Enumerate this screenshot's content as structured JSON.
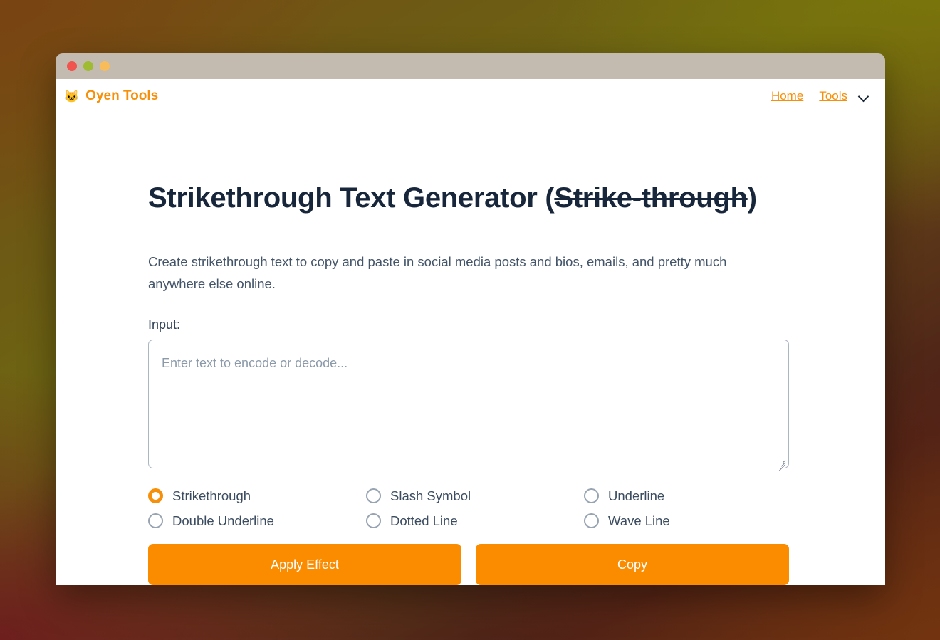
{
  "window": {
    "traffic_lights": [
      "close",
      "minimize",
      "maximize"
    ]
  },
  "header": {
    "brand_emoji": "🐱",
    "brand_name": "Oyen Tools",
    "nav": [
      {
        "label": "Home"
      },
      {
        "label": "Tools"
      }
    ],
    "nav_caret_icon": "chevron-down-icon"
  },
  "main": {
    "title_plain": "Strikethrough Text Generator (",
    "title_struck": "Strike-through",
    "title_tail": ")",
    "description": "Create strikethrough text to copy and paste in social media posts and bios, emails, and pretty much anywhere else online.",
    "input_label": "Input:",
    "input_placeholder": "Enter text to encode or decode...",
    "input_value": "",
    "options": [
      {
        "label": "Strikethrough",
        "selected": true
      },
      {
        "label": "Slash Symbol",
        "selected": false
      },
      {
        "label": "Underline",
        "selected": false
      },
      {
        "label": "Double Underline",
        "selected": false
      },
      {
        "label": "Dotted Line",
        "selected": false
      },
      {
        "label": "Wave Line",
        "selected": false
      }
    ],
    "apply_button": "Apply Effect",
    "copy_button": "Copy"
  },
  "colors": {
    "accent_orange": "#f6900b",
    "button_orange": "#fb8c00",
    "title_navy": "#17263a",
    "titlebar_gray": "#c3bbaf",
    "dot_red": "#f1544f",
    "dot_green": "#9fbb32",
    "dot_yellow": "#f8bc5a"
  }
}
